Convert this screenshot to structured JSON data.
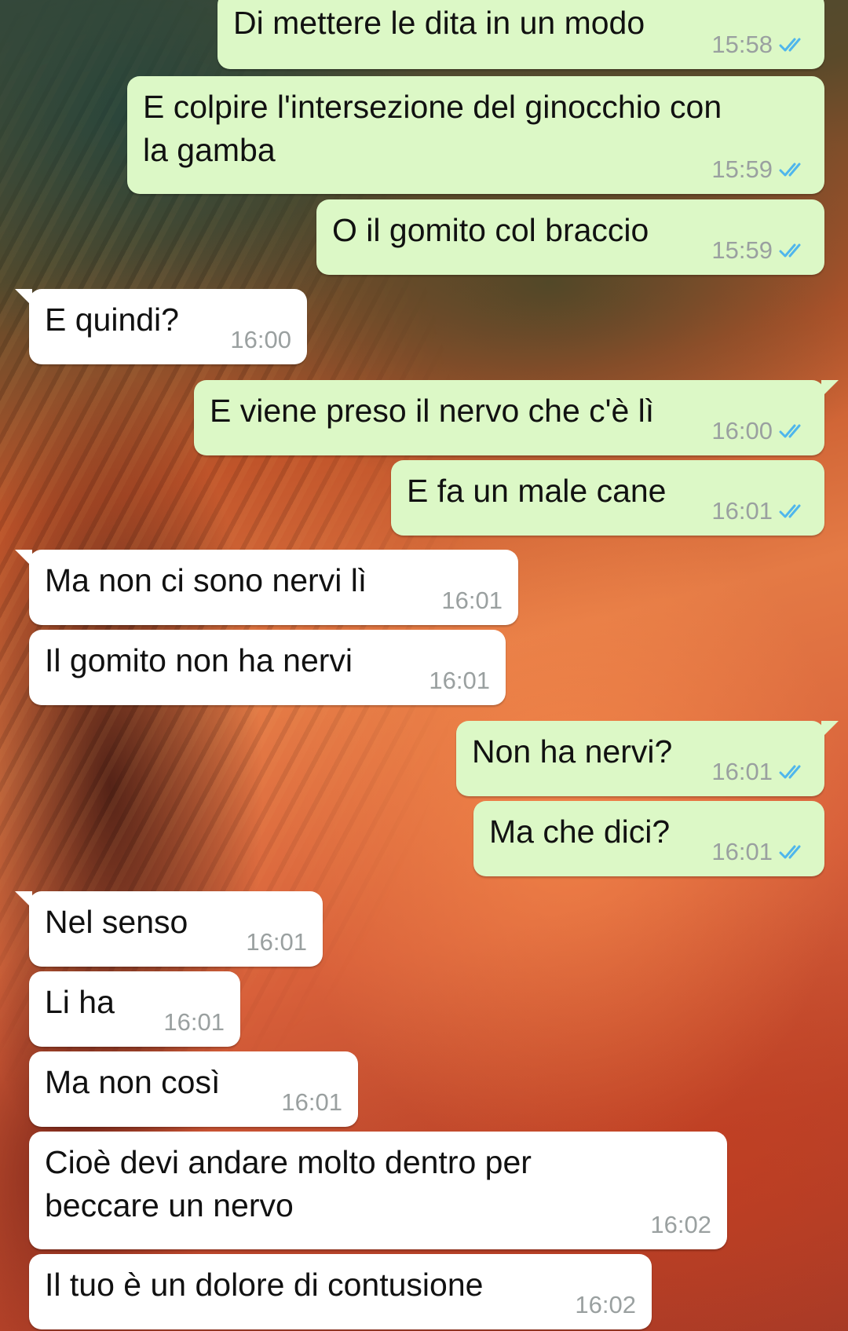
{
  "chat": {
    "messages": [
      {
        "dir": "out",
        "text": "Di mettere le dita in un modo",
        "time": "15:58"
      },
      {
        "dir": "out",
        "text": "E colpire l'intersezione del ginocchio con\nla gamba",
        "time": "15:59"
      },
      {
        "dir": "out",
        "text": "O il gomito col braccio",
        "time": "15:59"
      },
      {
        "dir": "in",
        "text": "E quindi?",
        "time": "16:00"
      },
      {
        "dir": "out",
        "text": "E viene preso il nervo che c'è lì",
        "time": "16:00"
      },
      {
        "dir": "out",
        "text": "E fa un male cane",
        "time": "16:01"
      },
      {
        "dir": "in",
        "text": "Ma non ci sono nervi lì",
        "time": "16:01"
      },
      {
        "dir": "in",
        "text": "Il gomito non ha nervi",
        "time": "16:01"
      },
      {
        "dir": "out",
        "text": "Non ha nervi?",
        "time": "16:01"
      },
      {
        "dir": "out",
        "text": "Ma che dici?",
        "time": "16:01"
      },
      {
        "dir": "in",
        "text": "Nel senso",
        "time": "16:01"
      },
      {
        "dir": "in",
        "text": "Li ha",
        "time": "16:01"
      },
      {
        "dir": "in",
        "text": "Ma non così",
        "time": "16:01"
      },
      {
        "dir": "in",
        "text": "Cioè devi andare molto dentro per\nbeccare un nervo",
        "time": "16:02"
      },
      {
        "dir": "in",
        "text": "Il tuo è un dolore di contusione",
        "time": "16:02"
      }
    ]
  },
  "icons": {
    "read_receipt": "double-check-icon"
  },
  "colors": {
    "outgoing_bubble": "#dcf8c6",
    "incoming_bubble": "#ffffff",
    "read_tick": "#4fb6ec",
    "timestamp": "#9aa0a0"
  }
}
